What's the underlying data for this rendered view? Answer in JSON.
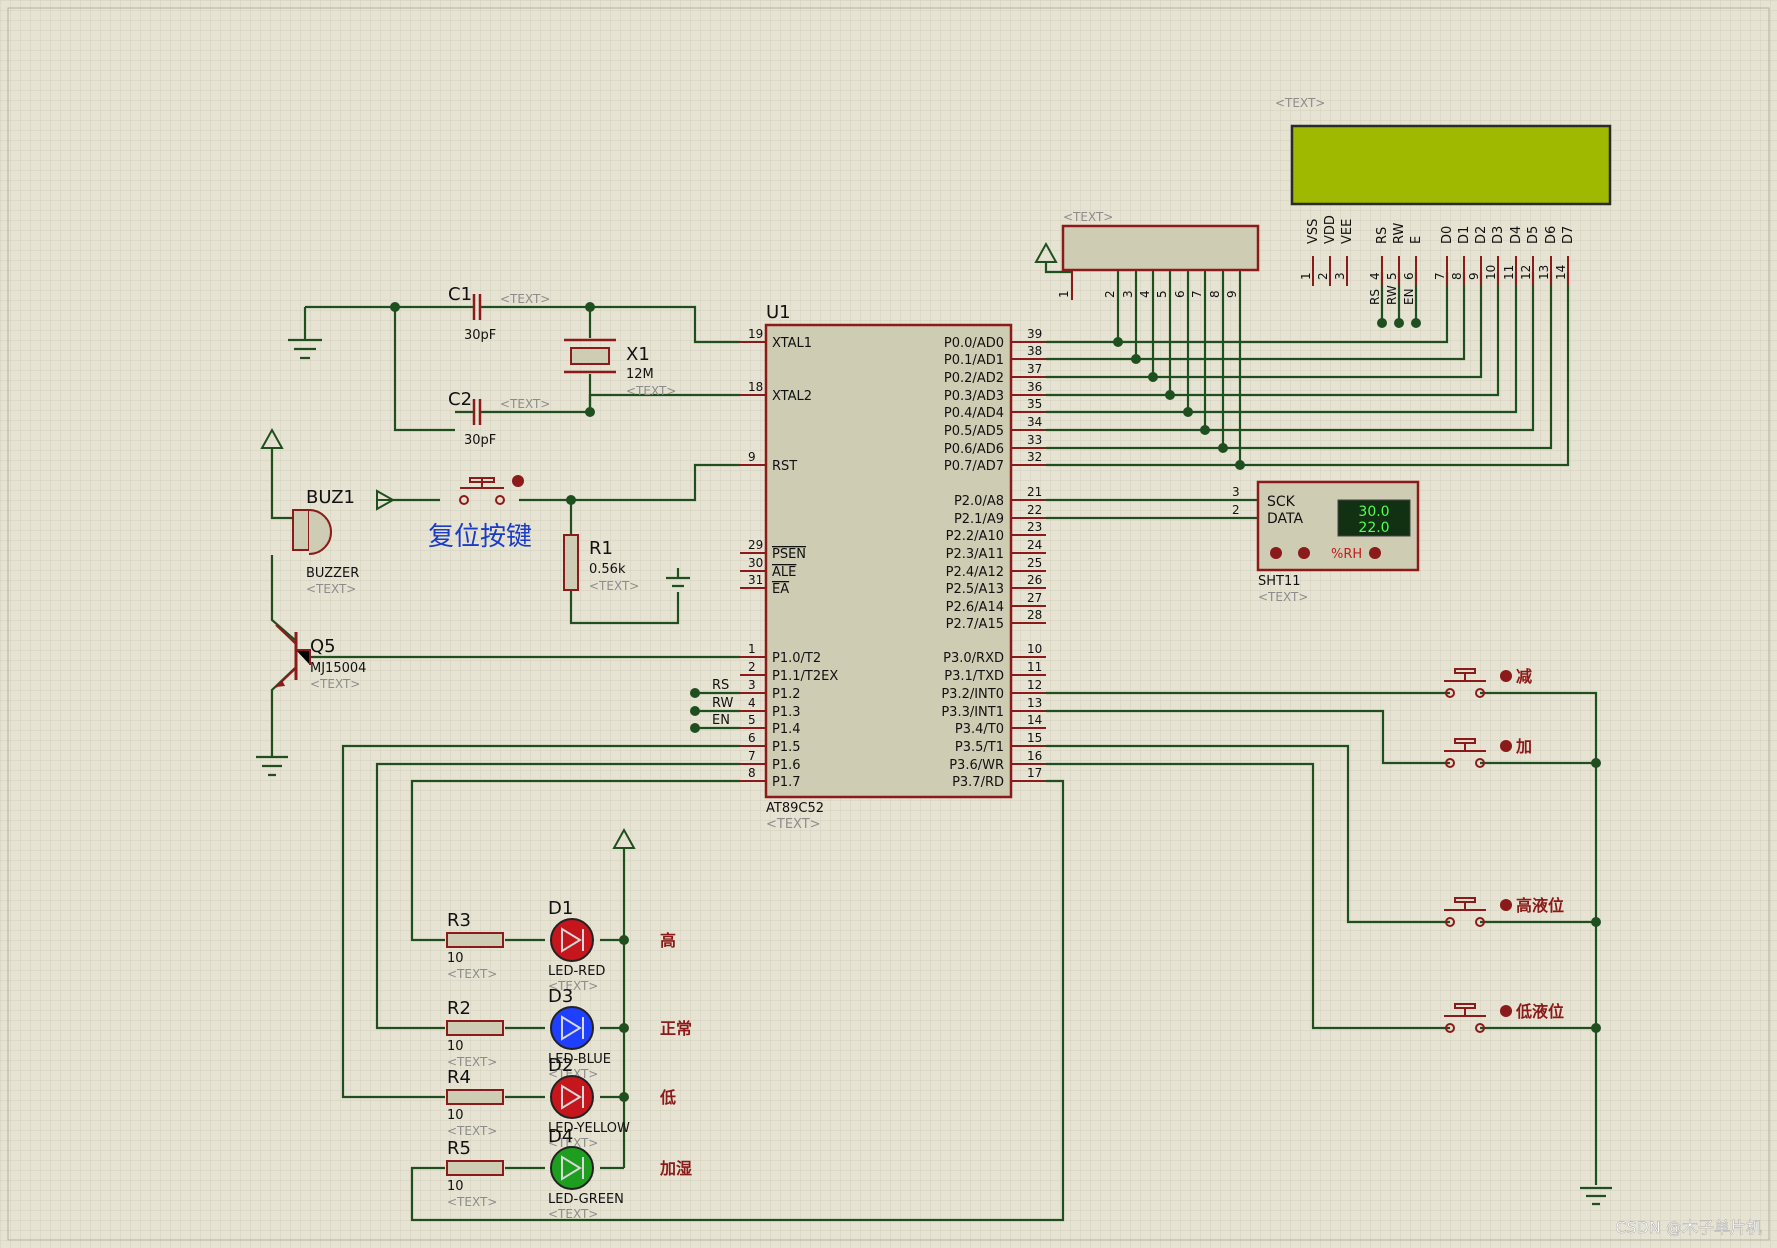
{
  "colors": {
    "background": "#e6e3d2",
    "grid": "#d2cfbd",
    "wire": "#1f4f1f",
    "component": "#8b1a1a",
    "ic_body": "#cfccb4",
    "lcd_screen": "#9fb800",
    "text": "#111111",
    "placeholder": "#8c8c8c",
    "label_cn": "#8b1a1a",
    "reset_label": "#1a3cc8"
  },
  "placeholder": "<TEXT>",
  "mcu": {
    "ref": "U1",
    "part": "AT89C52",
    "left_pins": [
      {
        "num": "19",
        "name": "XTAL1"
      },
      {
        "num": "18",
        "name": "XTAL2"
      },
      {
        "num": "9",
        "name": "RST"
      },
      {
        "num": "29",
        "name": "PSEN"
      },
      {
        "num": "30",
        "name": "ALE"
      },
      {
        "num": "31",
        "name": "EA"
      },
      {
        "num": "1",
        "name": "P1.0/T2"
      },
      {
        "num": "2",
        "name": "P1.1/T2EX"
      },
      {
        "num": "3",
        "name": "P1.2"
      },
      {
        "num": "4",
        "name": "P1.3"
      },
      {
        "num": "5",
        "name": "P1.4"
      },
      {
        "num": "6",
        "name": "P1.5"
      },
      {
        "num": "7",
        "name": "P1.6"
      },
      {
        "num": "8",
        "name": "P1.7"
      }
    ],
    "right_pins": [
      {
        "num": "39",
        "name": "P0.0/AD0"
      },
      {
        "num": "38",
        "name": "P0.1/AD1"
      },
      {
        "num": "37",
        "name": "P0.2/AD2"
      },
      {
        "num": "36",
        "name": "P0.3/AD3"
      },
      {
        "num": "35",
        "name": "P0.4/AD4"
      },
      {
        "num": "34",
        "name": "P0.5/AD5"
      },
      {
        "num": "33",
        "name": "P0.6/AD6"
      },
      {
        "num": "32",
        "name": "P0.7/AD7"
      },
      {
        "num": "21",
        "name": "P2.0/A8"
      },
      {
        "num": "22",
        "name": "P2.1/A9"
      },
      {
        "num": "23",
        "name": "P2.2/A10"
      },
      {
        "num": "24",
        "name": "P2.3/A11"
      },
      {
        "num": "25",
        "name": "P2.4/A12"
      },
      {
        "num": "26",
        "name": "P2.5/A13"
      },
      {
        "num": "27",
        "name": "P2.6/A14"
      },
      {
        "num": "28",
        "name": "P2.7/A15"
      },
      {
        "num": "10",
        "name": "P3.0/RXD"
      },
      {
        "num": "11",
        "name": "P3.1/TXD"
      },
      {
        "num": "12",
        "name": "P3.2/INT0"
      },
      {
        "num": "13",
        "name": "P3.3/INT1"
      },
      {
        "num": "14",
        "name": "P3.4/T0"
      },
      {
        "num": "15",
        "name": "P3.5/T1"
      },
      {
        "num": "16",
        "name": "P3.6/WR"
      },
      {
        "num": "17",
        "name": "P3.7/RD"
      }
    ],
    "net_labels": [
      "RS",
      "RW",
      "EN"
    ]
  },
  "capacitors": [
    {
      "ref": "C1",
      "value": "30pF"
    },
    {
      "ref": "C2",
      "value": "30pF"
    }
  ],
  "crystal": {
    "ref": "X1",
    "value": "12M"
  },
  "reset": {
    "label": "复位按键"
  },
  "r1": {
    "ref": "R1",
    "value": "0.56k"
  },
  "buzzer": {
    "ref": "BUZ1",
    "part": "BUZZER"
  },
  "transistor": {
    "ref": "Q5",
    "part": "MJ15004"
  },
  "resistor_pack": {
    "pins": [
      "1",
      "2",
      "3",
      "4",
      "5",
      "6",
      "7",
      "8",
      "9"
    ]
  },
  "lcd": {
    "pin_names": [
      "VSS",
      "VDD",
      "VEE",
      "RS",
      "RW",
      "E",
      "D0",
      "D1",
      "D2",
      "D3",
      "D4",
      "D5",
      "D6",
      "D7"
    ],
    "pin_nums": [
      "1",
      "2",
      "3",
      "4",
      "5",
      "6",
      "7",
      "8",
      "9",
      "10",
      "11",
      "12",
      "13",
      "14"
    ],
    "net_labels": [
      "RS",
      "RW",
      "EN"
    ]
  },
  "sensor": {
    "ref": "SHT11",
    "pin_sck": "SCK",
    "pin_data": "DATA",
    "pin_sck_num": "3",
    "pin_data_num": "2",
    "temperature": "30.0",
    "humidity": "22.0",
    "unit": "%RH"
  },
  "leds": [
    {
      "res_ref": "R3",
      "res_value": "10",
      "led_ref": "D1",
      "led_part": "LED-RED",
      "label": "高",
      "color": "#c4161c"
    },
    {
      "res_ref": "R2",
      "res_value": "10",
      "led_ref": "D3",
      "led_part": "LED-BLUE",
      "label": "正常",
      "color": "#1f3fff"
    },
    {
      "res_ref": "R4",
      "res_value": "10",
      "led_ref": "D2",
      "led_part": "LED-YELLOW",
      "label": "低",
      "color": "#c4161c"
    },
    {
      "res_ref": "R5",
      "res_value": "10",
      "led_ref": "D4",
      "led_part": "LED-GREEN",
      "label": "加湿",
      "color": "#1e9e1e"
    }
  ],
  "buttons": [
    {
      "label": "减"
    },
    {
      "label": "加"
    },
    {
      "label": "高液位"
    },
    {
      "label": "低液位"
    }
  ],
  "watermark": "CSDN @木子单片机"
}
